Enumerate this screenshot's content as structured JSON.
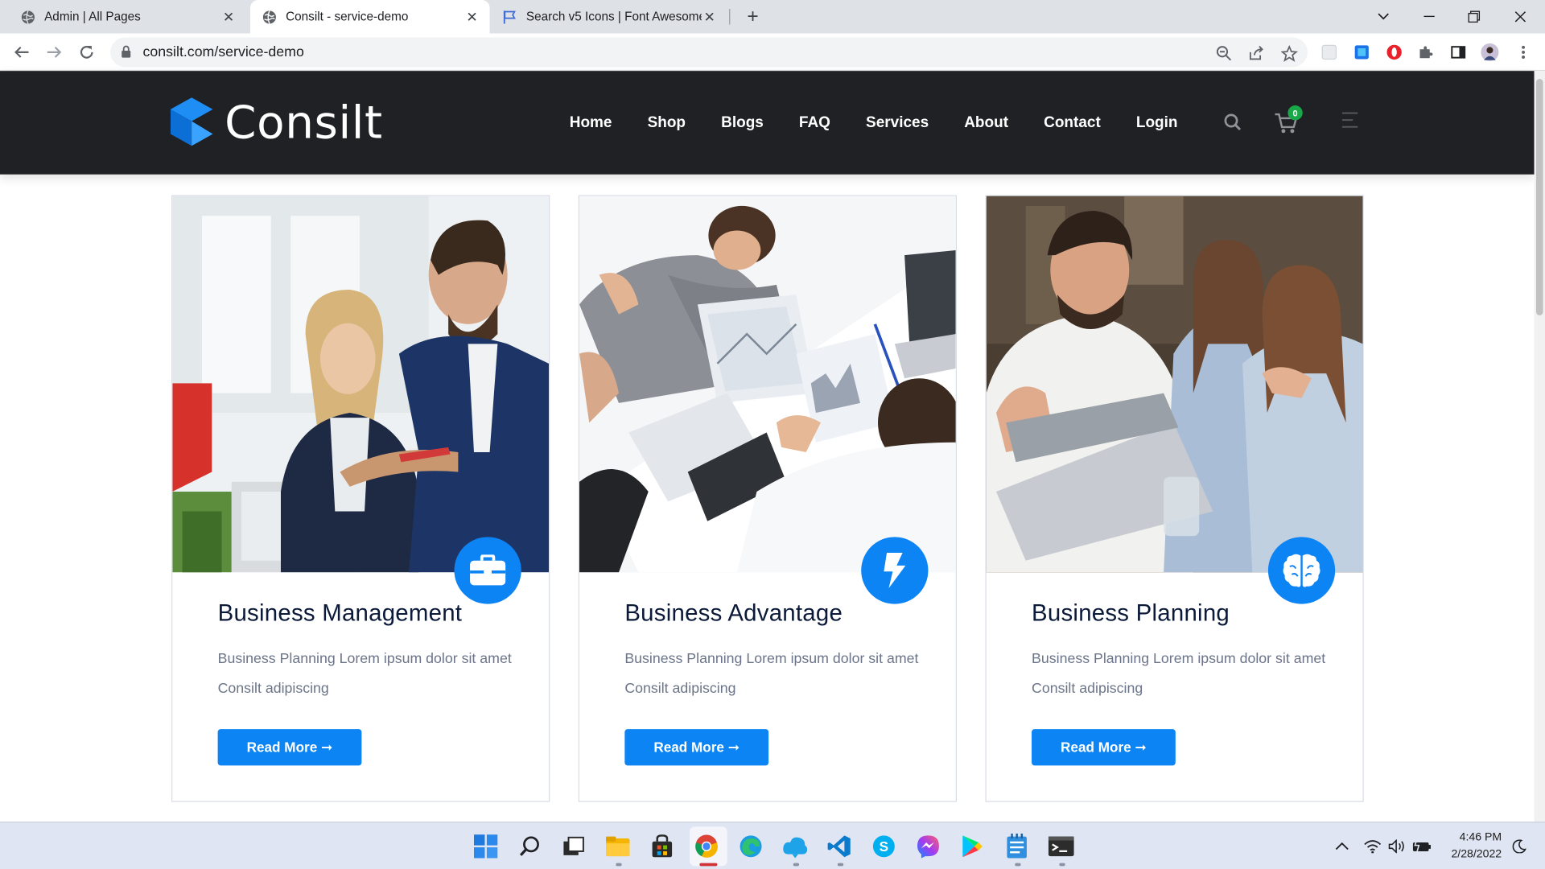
{
  "browser": {
    "tabs": [
      {
        "title": "Admin | All Pages",
        "icon": "globe-icon",
        "active": false
      },
      {
        "title": "Consilt - service-demo",
        "icon": "globe-icon",
        "active": true
      },
      {
        "title": "Search v5 Icons | Font Awesome",
        "icon": "flag-icon",
        "active": false
      }
    ],
    "url": "consilt.com/service-demo"
  },
  "site": {
    "brand": "Consilt",
    "accent_color": "#0d84f4",
    "nav": [
      "Home",
      "Shop",
      "Blogs",
      "FAQ",
      "Services",
      "About",
      "Contact",
      "Login"
    ],
    "cart_count": "0"
  },
  "cards": [
    {
      "title": "Business Management",
      "desc": "Business Planning Lorem ipsum dolor sit amet Consilt adipiscing",
      "button": "Read More ➞",
      "icon": "briefcase-icon"
    },
    {
      "title": "Business Advantage",
      "desc": "Business Planning Lorem ipsum dolor sit amet Consilt adipiscing",
      "button": "Read More ➞",
      "icon": "bolt-icon"
    },
    {
      "title": "Business Planning",
      "desc": "Business Planning Lorem ipsum dolor sit amet Consilt adipiscing",
      "button": "Read More ➞",
      "icon": "brain-icon"
    }
  ],
  "taskbar": {
    "time": "4:46 PM",
    "date": "2/28/2022"
  }
}
